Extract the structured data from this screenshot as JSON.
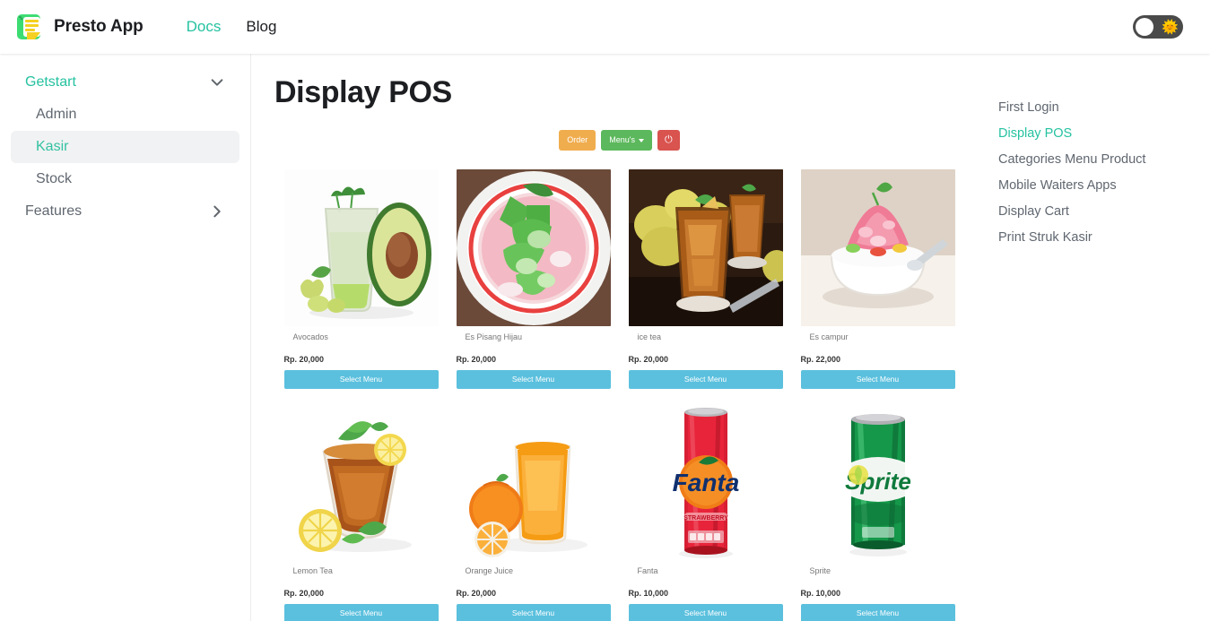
{
  "navbar": {
    "brand_title": "Presto App",
    "logo_icon": "green-notebook-logo",
    "links": [
      {
        "label": "Docs",
        "active": true
      },
      {
        "label": "Blog",
        "active": false
      }
    ],
    "theme_toggle": {
      "icon": "sun-icon",
      "state": "light"
    }
  },
  "sidebar": {
    "items": [
      {
        "label": "Getstart",
        "type": "category",
        "expanded": true,
        "icon": "chevron-down-icon"
      },
      {
        "label": "Admin",
        "type": "link",
        "active": false
      },
      {
        "label": "Kasir",
        "type": "link",
        "active": true
      },
      {
        "label": "Stock",
        "type": "link",
        "active": false
      },
      {
        "label": "Features",
        "type": "category",
        "expanded": false,
        "icon": "chevron-right-icon"
      }
    ]
  },
  "main": {
    "title": "Display POS",
    "pos": {
      "toolbar": [
        {
          "label": "Order",
          "style": "order"
        },
        {
          "label": "Menu's",
          "style": "menus",
          "icon": "caret-down-icon"
        },
        {
          "label": "",
          "style": "power",
          "icon": "power-icon"
        }
      ],
      "select_button_label": "Select Menu",
      "products": [
        {
          "name": "Avocados",
          "price": "Rp. 20,000",
          "image": "avocado-juice"
        },
        {
          "name": "Es Pisang Hijau",
          "price": "Rp. 20,000",
          "image": "es-pisang-hijau"
        },
        {
          "name": "ice tea",
          "price": "Rp. 20,000",
          "image": "ice-tea"
        },
        {
          "name": "Es campur",
          "price": "Rp. 22,000",
          "image": "es-campur"
        },
        {
          "name": "Lemon Tea",
          "price": "Rp. 20,000",
          "image": "lemon-tea"
        },
        {
          "name": "Orange Juice",
          "price": "Rp. 20,000",
          "image": "orange-juice"
        },
        {
          "name": "Fanta",
          "price": "Rp. 10,000",
          "image": "fanta-can"
        },
        {
          "name": "Sprite",
          "price": "Rp. 10,000",
          "image": "sprite-can"
        }
      ]
    }
  },
  "toc": {
    "items": [
      {
        "label": "First Login",
        "active": false
      },
      {
        "label": "Display POS",
        "active": true
      },
      {
        "label": "Categories Menu Product",
        "active": false
      },
      {
        "label": "Mobile Waiters Apps",
        "active": false
      },
      {
        "label": "Display Cart",
        "active": false
      },
      {
        "label": "Print Struk Kasir",
        "active": false
      }
    ]
  },
  "colors": {
    "accent": "#25c2a0",
    "order_button": "#f0ad4e",
    "menus_button": "#5cb85c",
    "power_button": "#d9534f",
    "select_button": "#5bc0de"
  }
}
